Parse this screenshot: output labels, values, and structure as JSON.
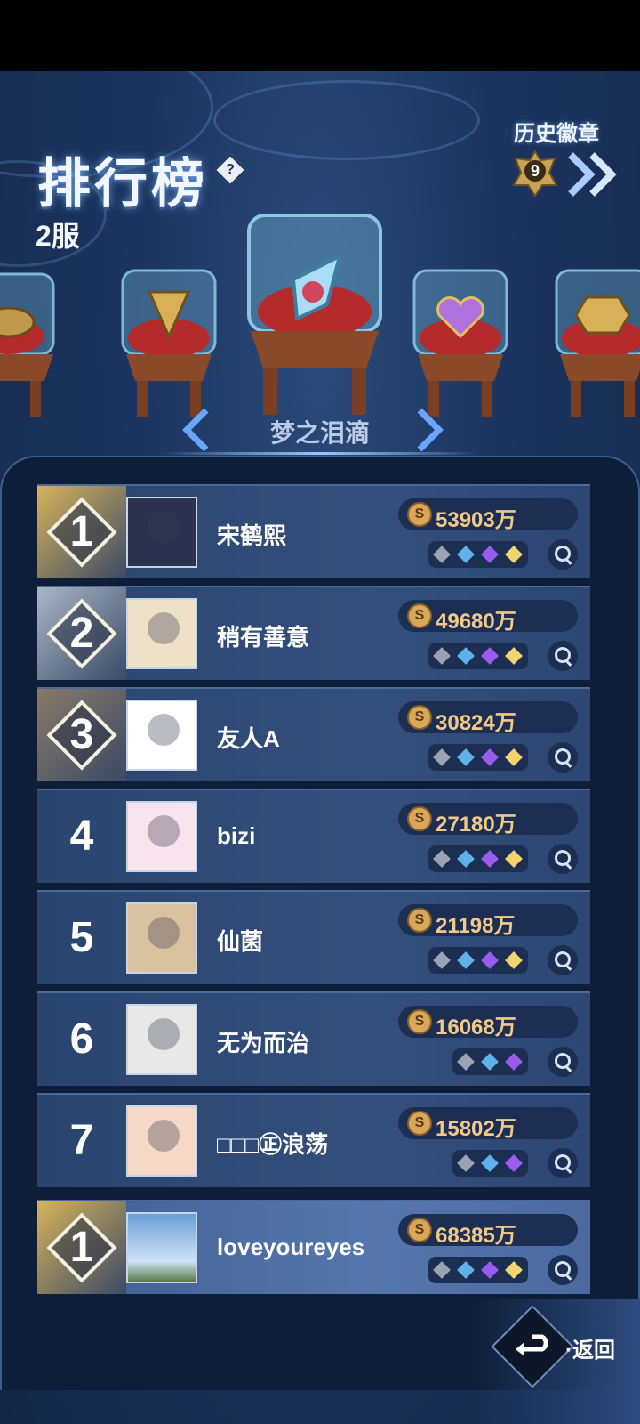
{
  "header": {
    "title": "排行榜",
    "help_icon_text": "?",
    "server": "2服",
    "history_label": "历史徽章",
    "history_count": "9"
  },
  "badge_showcase": {
    "selected_name": "梦之泪滴",
    "items": [
      "turtle-badge",
      "golden-goblet-badge",
      "dream-teardrop-badge",
      "heart-wings-badge",
      "coin-badge"
    ]
  },
  "leaderboard": [
    {
      "rank": "1",
      "name": "宋鹤熙",
      "score": "53903万",
      "gems": [
        "gray",
        "blue",
        "purple",
        "gold"
      ]
    },
    {
      "rank": "2",
      "name": "稍有善意",
      "score": "49680万",
      "gems": [
        "gray",
        "blue",
        "purple",
        "gold"
      ]
    },
    {
      "rank": "3",
      "name": "友人A",
      "score": "30824万",
      "gems": [
        "gray",
        "blue",
        "purple",
        "gold"
      ]
    },
    {
      "rank": "4",
      "name": "bizi",
      "score": "27180万",
      "gems": [
        "gray",
        "blue",
        "purple",
        "gold"
      ]
    },
    {
      "rank": "5",
      "name": "仙菌",
      "score": "21198万",
      "gems": [
        "gray",
        "blue",
        "purple",
        "gold"
      ]
    },
    {
      "rank": "6",
      "name": "无为而治",
      "score": "16068万",
      "gems": [
        "gray",
        "blue",
        "purple"
      ]
    },
    {
      "rank": "7",
      "name": "□□□㊣浪荡",
      "score": "15802万",
      "gems": [
        "gray",
        "blue",
        "purple"
      ]
    }
  ],
  "my_entry": {
    "rank": "1",
    "name": "loveyoureyes",
    "score": "68385万",
    "gems": [
      "gray",
      "blue",
      "purple",
      "gold"
    ]
  },
  "coin_symbol": "S",
  "footer": {
    "back_label": "·返回"
  },
  "colors": {
    "gold": "#d7b25a",
    "silver": "#aab6c6",
    "bronze": "#8a7a68",
    "gem_gray": "#9aa3b2",
    "gem_blue": "#5fb1ea",
    "gem_purple": "#9a5cf0",
    "gem_gold": "#f0d470"
  }
}
